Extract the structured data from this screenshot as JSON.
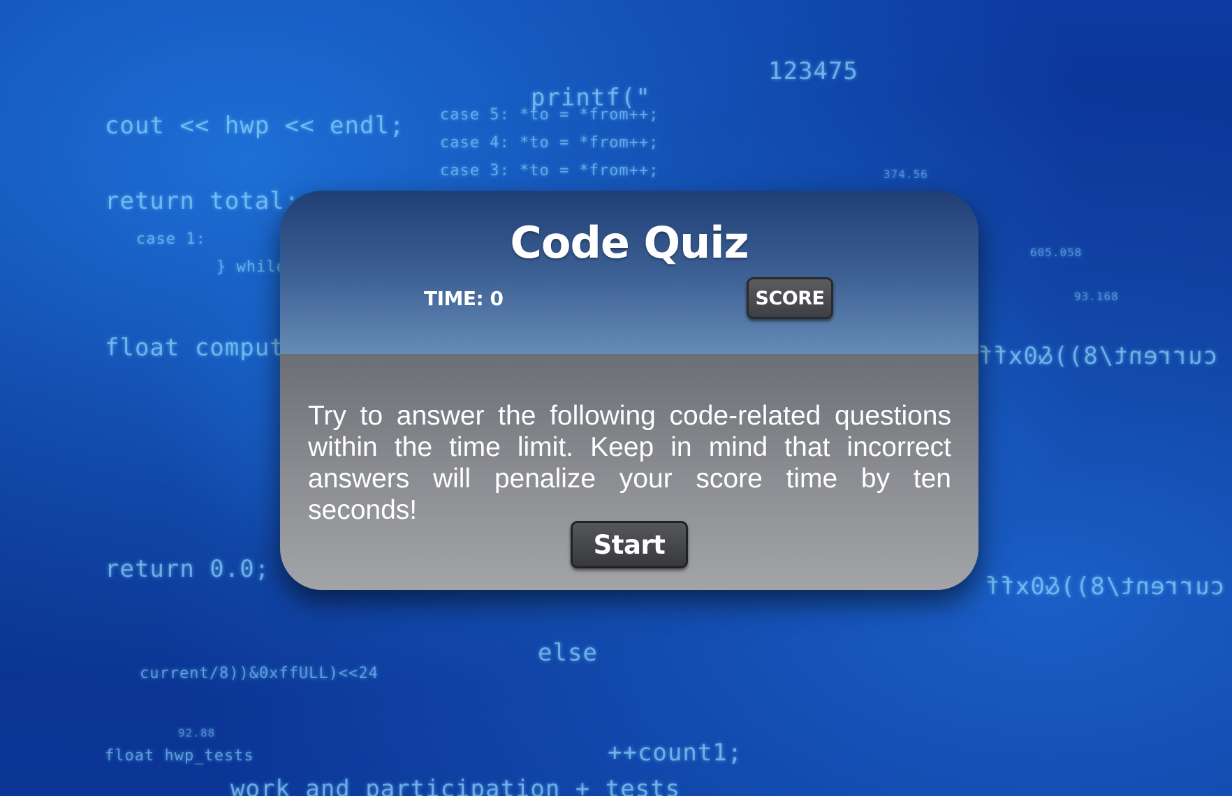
{
  "quiz": {
    "title": "Code Quiz",
    "time_label": "TIME: 0",
    "score_button_label": "SCORE",
    "instructions": "Try to answer the following code-related questions within the time limit. Keep in mind that incorrect answers will penalize your score time by ten seconds!",
    "start_button_label": "Start"
  },
  "background": {
    "description_lines": [
      "case 5:  *to = *from++;",
      "case 4:  *to = *from++;",
      "case 3:  *to = *from++;",
      "printf(\"",
      "cout << hwp << endl;",
      "return total;",
      "float compute_score(",
      "current/8))&0xffULL)<<24",
      "else",
      "++count1;",
      "float hwp_tests",
      "return 0.0;",
      "work and participation + tests",
      "} while",
      "case 1:",
      "current/8))&0xff",
      "123475",
      "605.058",
      "93.168",
      "374.56",
      "92.88"
    ],
    "colors": {
      "deep_blue": "#0a2f8a",
      "glow_blue": "#1d6fd6",
      "code_cyan": "#8cdcff"
    }
  }
}
